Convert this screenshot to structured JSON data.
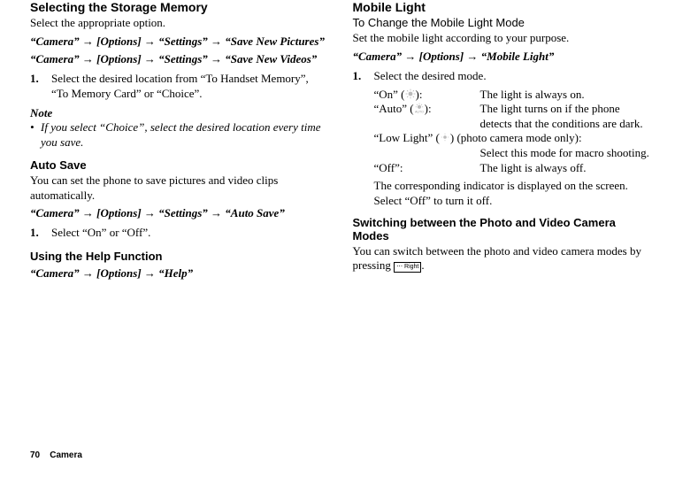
{
  "left": {
    "storage": {
      "heading": "Selecting the Storage Memory",
      "desc": "Select the appropriate option.",
      "path1": "“Camera” → [Options] → “Settings” → “Save New Pictures”",
      "path2": "“Camera” → [Options] → “Settings” → “Save New Videos”",
      "step1_num": "1.",
      "step1": "Select the desired location from “To Handset Memory”, “To Memory Card” or “Choice”.",
      "note_label": "Note",
      "note_body": "If you select “Choice”, select the desired location every time you save."
    },
    "autosave": {
      "heading": "Auto Save",
      "desc": "You can set the phone to save pictures and video clips automatically.",
      "path": "“Camera” → [Options] → “Settings” → “Auto Save”",
      "step1_num": "1.",
      "step1": "Select “On” or “Off”."
    },
    "help": {
      "heading": "Using the Help Function",
      "path": "“Camera” → [Options] → “Help”"
    }
  },
  "right": {
    "mobile": {
      "heading": "Mobile Light",
      "sub": "To Change the Mobile Light Mode",
      "desc": "Set the mobile light according to your purpose.",
      "path": "“Camera” → [Options] → “Mobile Light”",
      "step1_num": "1.",
      "step1": "Select the desired mode.",
      "on_key_pre": "“On” (",
      "on_key_post": "):",
      "on_val": "The light is always on.",
      "auto_key_pre": "“Auto” (",
      "auto_key_post": "):",
      "auto_val1": "The light turns on if the phone",
      "auto_val2": "detects that the conditions are dark.",
      "low_key_pre": "“Low Light” (",
      "low_key_post": ") (photo camera mode only):",
      "low_val": "Select this mode for macro shooting.",
      "off_key": "“Off”:",
      "off_val": "The light is always off.",
      "screen1": "The corresponding indicator is displayed on the screen. Select “Off” to turn it off."
    },
    "switch": {
      "heading": "Switching between the Photo and Video Camera Modes",
      "desc_pre": "You can switch between the photo and video camera modes by pressing ",
      "desc_post": ".",
      "key_label": "⋯ Right"
    }
  },
  "footer": {
    "page": "70",
    "section": "Camera"
  }
}
